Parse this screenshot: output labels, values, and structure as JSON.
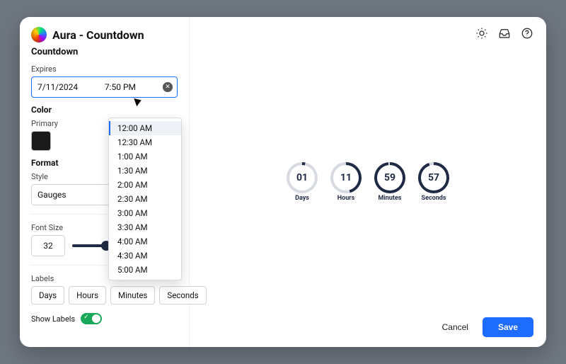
{
  "app": {
    "title": "Aura - Countdown"
  },
  "sidebar": {
    "subtitle": "Countdown",
    "expires_label": "Expires",
    "date_value": "7/11/2024",
    "time_value": "7:50 PM",
    "color_header": "Color",
    "primary_label": "Primary",
    "primary_swatch": "#1a1a1a",
    "format_header": "Format",
    "style_label": "Style",
    "style_value": "Gauges",
    "font_size_label": "Font Size",
    "font_size_value": "32",
    "slider_percent": 32,
    "labels_label": "Labels",
    "labels": [
      "Days",
      "Hours",
      "Minutes",
      "Seconds"
    ],
    "show_labels_label": "Show Labels",
    "show_labels_on": true
  },
  "time_menu": {
    "options": [
      "12:00 AM",
      "12:30 AM",
      "1:00 AM",
      "1:30 AM",
      "2:00 AM",
      "2:30 AM",
      "3:00 AM",
      "3:30 AM",
      "4:00 AM",
      "4:30 AM",
      "5:00 AM"
    ],
    "selected_index": 0
  },
  "preview": {
    "gauges": [
      {
        "value": "01",
        "unit": "Days",
        "progress_deg": 12
      },
      {
        "value": "11",
        "unit": "Hours",
        "progress_deg": 165
      },
      {
        "value": "59",
        "unit": "Minutes",
        "progress_deg": 354
      },
      {
        "value": "57",
        "unit": "Seconds",
        "progress_deg": 342
      }
    ]
  },
  "footer": {
    "cancel": "Cancel",
    "save": "Save"
  }
}
